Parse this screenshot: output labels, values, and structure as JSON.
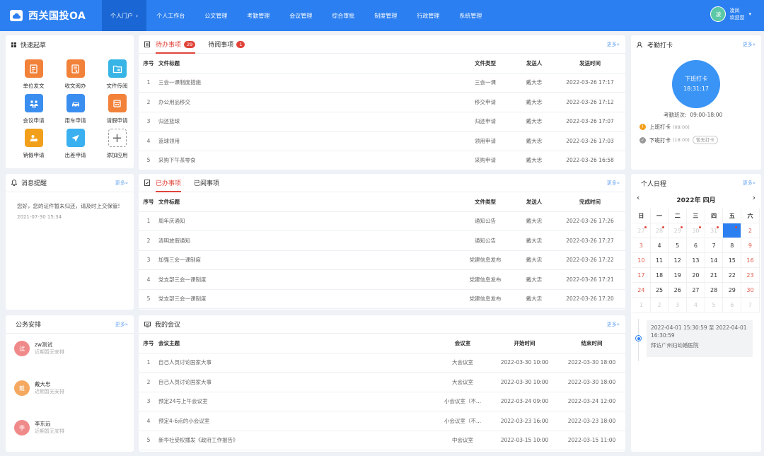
{
  "header": {
    "app_title": "西关国投OA",
    "nav": [
      {
        "label": "个人门户",
        "chevron": "›"
      },
      {
        "label": "个人工作台"
      },
      {
        "label": "公文管理"
      },
      {
        "label": "考勤管理"
      },
      {
        "label": "会议管理"
      },
      {
        "label": "综合审批"
      },
      {
        "label": "制度管理"
      },
      {
        "label": "行政管理"
      },
      {
        "label": "系统管理"
      }
    ],
    "user": {
      "avatar": "凌",
      "name": "凌凤",
      "greeting": "欢迎您",
      "caret": "▾"
    }
  },
  "quick_start": {
    "title": "快速起草",
    "items": [
      {
        "label": "单位发文",
        "color": "#f2813a",
        "icon": "doc-icon"
      },
      {
        "label": "收文阅办",
        "color": "#f2813a",
        "icon": "doc-receive-icon"
      },
      {
        "label": "文件传阅",
        "color": "#37b4e6",
        "icon": "file-share-icon"
      },
      {
        "label": "会议申请",
        "color": "#3a8ef0",
        "icon": "meeting-icon"
      },
      {
        "label": "用车申请",
        "color": "#3a8ef0",
        "icon": "car-icon"
      },
      {
        "label": "请假申请",
        "color": "#f2813a",
        "icon": "leave-icon"
      },
      {
        "label": "销假申请",
        "color": "#f2a01c",
        "icon": "leave-cancel-icon"
      },
      {
        "label": "出差申请",
        "color": "#3ab0f0",
        "icon": "plane-icon"
      },
      {
        "label": "添加应用",
        "color": "",
        "icon": "add-icon",
        "glyph": "+"
      }
    ]
  },
  "messages": {
    "title": "消息提醒",
    "more": "更多»",
    "items": [
      {
        "text": "您好，您的证件暂未归还，请及时上交保管!",
        "time": "2021-07-30 15:34"
      }
    ]
  },
  "schedule": {
    "title": "公务安排",
    "more": "更多»",
    "people": [
      {
        "avatar": "试",
        "name": "zw测试",
        "status": "近期暂无安排",
        "color": "#f08a8a"
      },
      {
        "avatar": "戴",
        "name": "戴大忠",
        "status": "近期暂无安排",
        "color": "#f4a860"
      },
      {
        "avatar": "李",
        "name": "李东远",
        "status": "近期暂无安排",
        "color": "#f08a8a"
      }
    ]
  },
  "todo": {
    "tab_pending": "待办事项",
    "pending_count": "29",
    "tab_to_read": "待阅事项",
    "to_read_count": "1",
    "more": "更多»",
    "columns": [
      "序号",
      "文件标题",
      "文件类型",
      "发送人",
      "发送时间"
    ],
    "rows": [
      [
        "1",
        "三会一课制度措施",
        "三会一课",
        "戴大忠",
        "2022-03-26 17:17"
      ],
      [
        "2",
        "办公用品移交",
        "移交申请",
        "戴大忠",
        "2022-03-26 17:12"
      ],
      [
        "3",
        "归还篮球",
        "归还申请",
        "戴大忠",
        "2022-03-26 17:07"
      ],
      [
        "4",
        "篮球领用",
        "领用申请",
        "戴大忠",
        "2022-03-26 17:03"
      ],
      [
        "5",
        "采购下午茶零食",
        "采购申请",
        "戴大忠",
        "2022-03-26 16:58"
      ]
    ]
  },
  "done": {
    "tab_done": "已办事项",
    "tab_read": "已阅事项",
    "more": "更多»",
    "columns": [
      "序号",
      "文件标题",
      "文件类型",
      "发送人",
      "完成时间"
    ],
    "rows": [
      [
        "1",
        "周年庆通知",
        "通知公告",
        "戴大忠",
        "2022-03-26 17:26"
      ],
      [
        "2",
        "清明放假通知",
        "通知公告",
        "戴大忠",
        "2022-03-26 17:27"
      ],
      [
        "3",
        "加强三会一课制度",
        "党建信息发布",
        "戴大忠",
        "2022-03-26 17:22"
      ],
      [
        "4",
        "党支部三会一课制度",
        "党建信息发布",
        "戴大忠",
        "2022-03-26 17:21"
      ],
      [
        "5",
        "党支部三会一课制度",
        "党建信息发布",
        "戴大忠",
        "2022-03-26 17:20"
      ]
    ]
  },
  "meetings": {
    "title": "我的会议",
    "more": "更多»",
    "columns": [
      "序号",
      "会议主题",
      "会议室",
      "开始时间",
      "结束时间"
    ],
    "rows": [
      [
        "1",
        "自己人员讨论国家大事",
        "大会议室",
        "2022-03-30 10:00",
        "2022-03-30 18:00"
      ],
      [
        "2",
        "自己人员讨论国家大事",
        "大会议室",
        "2022-03-30 10:00",
        "2022-03-30 18:00"
      ],
      [
        "3",
        "预定24号上午会议室",
        "小会议室（不...",
        "2022-03-24 09:00",
        "2022-03-24 12:00"
      ],
      [
        "4",
        "预定4-6点的小会议室",
        "小会议室（不...",
        "2022-03-23 16:00",
        "2022-03-23 18:00"
      ],
      [
        "5",
        "新华社受权播发《政府工作报告》",
        "中会议室",
        "2022-03-15 10:00",
        "2022-03-15 11:00"
      ]
    ]
  },
  "attendance": {
    "title": "考勤打卡",
    "more": "更多»",
    "clock_label": "下班打卡",
    "clock_time": "18:31:17",
    "shift_label": "考勤班次:",
    "shift_time": "09:00-18:00",
    "punches": [
      {
        "label": "上班打卡",
        "time": "(09:00)",
        "tag": "",
        "color": "#f2a01c",
        "glyph": "!"
      },
      {
        "label": "下班打卡",
        "time": "(18:00)",
        "tag": "暂无打卡",
        "color": "#999999",
        "glyph": "✓"
      }
    ]
  },
  "calendar": {
    "title": "个人日程",
    "more": "更多»",
    "month_label": "2022年 四月",
    "prev": "‹",
    "next": "›",
    "weekdays": [
      "日",
      "一",
      "二",
      "三",
      "四",
      "五",
      "六"
    ],
    "days": [
      {
        "d": "27",
        "muted": true,
        "mark": true
      },
      {
        "d": "28",
        "muted": true,
        "mark": true
      },
      {
        "d": "29",
        "muted": true,
        "mark": true
      },
      {
        "d": "30",
        "muted": true,
        "mark": true
      },
      {
        "d": "31",
        "muted": true,
        "mark": true
      },
      {
        "d": "1",
        "today": true,
        "mark": true
      },
      {
        "d": "2",
        "red": true
      },
      {
        "d": "3",
        "red": true
      },
      {
        "d": "4"
      },
      {
        "d": "5"
      },
      {
        "d": "6"
      },
      {
        "d": "7"
      },
      {
        "d": "8"
      },
      {
        "d": "9",
        "red": true
      },
      {
        "d": "10",
        "red": true
      },
      {
        "d": "11"
      },
      {
        "d": "12"
      },
      {
        "d": "13"
      },
      {
        "d": "14"
      },
      {
        "d": "15"
      },
      {
        "d": "16",
        "red": true
      },
      {
        "d": "17",
        "red": true
      },
      {
        "d": "18"
      },
      {
        "d": "19"
      },
      {
        "d": "20"
      },
      {
        "d": "21"
      },
      {
        "d": "22"
      },
      {
        "d": "23",
        "red": true
      },
      {
        "d": "24",
        "red": true
      },
      {
        "d": "25"
      },
      {
        "d": "26"
      },
      {
        "d": "27"
      },
      {
        "d": "28"
      },
      {
        "d": "29"
      },
      {
        "d": "30",
        "red": true
      },
      {
        "d": "1",
        "muted": true
      },
      {
        "d": "2",
        "muted": true
      },
      {
        "d": "3",
        "muted": true
      },
      {
        "d": "4",
        "muted": true
      },
      {
        "d": "5",
        "muted": true
      },
      {
        "d": "6",
        "muted": true
      },
      {
        "d": "7",
        "muted": true
      }
    ],
    "event": {
      "time": "2022-04-01 15:30:59 至 2022-04-01 16:30:59",
      "text": "拜访广州妇幼婚医院"
    }
  }
}
